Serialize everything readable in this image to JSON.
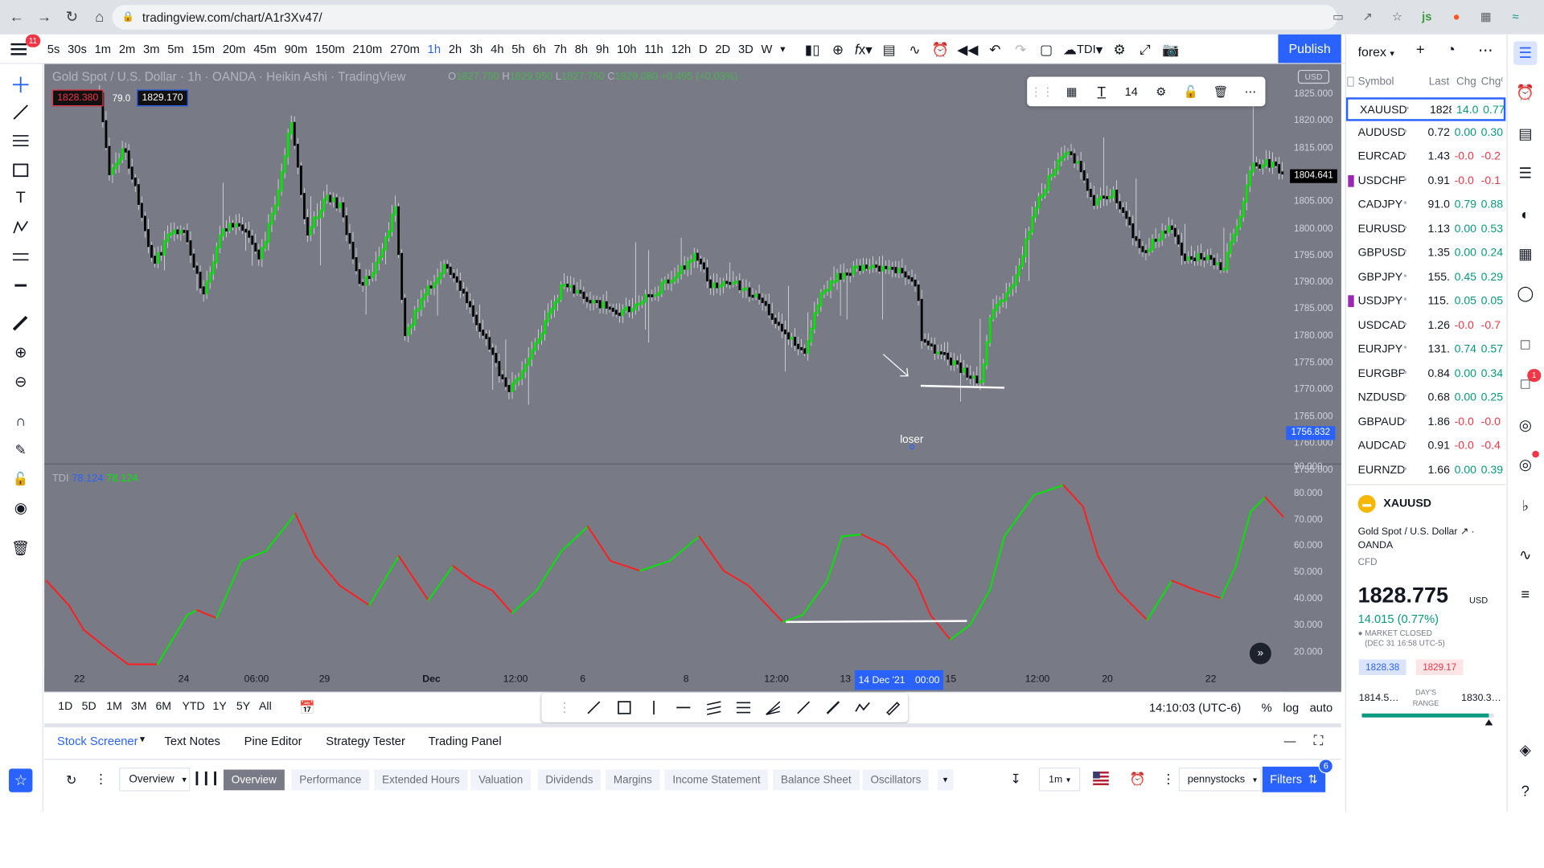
{
  "browser": {
    "url": "tradingview.com/chart/A1r3Xv47/"
  },
  "header": {
    "menu_badge": "11",
    "intervals": [
      "5s",
      "30s",
      "1m",
      "2m",
      "3m",
      "5m",
      "15m",
      "20m",
      "45m",
      "90m",
      "150m",
      "210m",
      "270m",
      "1h",
      "2h",
      "3h",
      "4h",
      "5h",
      "6h",
      "7h",
      "8h",
      "9h",
      "10h",
      "11h",
      "12h",
      "D",
      "2D",
      "3D",
      "W"
    ],
    "active_interval": "1h",
    "indicator_name": "TDI",
    "publish": "Publish"
  },
  "chart": {
    "symbol_title": "Gold Spot / U.S. Dollar · 1h · OANDA · Heikin Ashi · TradingView",
    "ohlc": {
      "o": "1827.750",
      "h": "1829.950",
      "l": "1827.750",
      "c": "1829.080",
      "chg": "+0.495 (+0.03%)"
    },
    "sell": "1828.380",
    "spread": "79.0",
    "buy": "1829.170",
    "currency": "USD",
    "price_ticks": [
      "1825.000",
      "1820.000",
      "1815.000",
      "1810.000",
      "1805.000",
      "1800.000",
      "1795.000",
      "1790.000",
      "1785.000",
      "1780.000",
      "1775.000",
      "1770.000",
      "1765.000",
      "1760.000",
      "1755.000"
    ],
    "last_price_label": "1804.641",
    "crosshair_price": "1756.832",
    "float_toolbar_size": "14",
    "annotation": "loser",
    "tdi_label": "TDI",
    "tdi_v1": "78.124",
    "tdi_v2": "78.124",
    "tdi_ticks": [
      "90.000",
      "80.000",
      "70.000",
      "60.000",
      "50.000",
      "40.000",
      "30.000",
      "20.000"
    ],
    "time_ticks": [
      "22",
      "24",
      "06:00",
      "29",
      "Dec",
      "12:00",
      "6",
      "8",
      "12:00",
      "13",
      "15",
      "12:00",
      "20",
      "22"
    ],
    "crosshair_date": "14 Dec '21",
    "crosshair_time": "00:00",
    "colors": {
      "bg": "#787b86",
      "up": "#00e600",
      "down": "#000000",
      "tdi_up": "#00e600",
      "tdi_down": "#ff1e1e"
    }
  },
  "bottom_bar": {
    "ranges": [
      "1D",
      "5D",
      "1M",
      "3M",
      "6M",
      "YTD",
      "1Y",
      "5Y",
      "All"
    ],
    "clock": "14:10:03 (UTC-6)",
    "pct": "%",
    "log": "log",
    "auto": "auto"
  },
  "panels": {
    "tabs": [
      "Stock Screener",
      "Text Notes",
      "Pine Editor",
      "Strategy Tester",
      "Trading Panel"
    ],
    "screener_view": "Overview",
    "chips": [
      "Overview",
      "Performance",
      "Extended Hours",
      "Valuation",
      "Dividends",
      "Margins",
      "Income Statement",
      "Balance Sheet",
      "Oscillators"
    ],
    "interval": "1m",
    "watch": "pennystocks",
    "filters": "Filters",
    "filters_badge": "6"
  },
  "watchlist": {
    "name": "forex",
    "headers": [
      "Symbol",
      "Last",
      "Chg",
      "Chg%"
    ],
    "rows": [
      {
        "s": "XAUUSD",
        "l": "1828",
        "c": "14.0",
        "p": "0.77",
        "t": "pos"
      },
      {
        "s": "AUDUSD",
        "l": "0.72",
        "c": "0.00",
        "p": "0.30",
        "t": "pos"
      },
      {
        "s": "EURCAD",
        "l": "1.43",
        "c": "-0.0",
        "p": "-0.2",
        "t": "neg"
      },
      {
        "s": "USDCHF",
        "l": "0.91",
        "c": "-0.0",
        "p": "-0.1",
        "t": "neg",
        "flag": true
      },
      {
        "s": "CADJPY",
        "l": "91.0",
        "c": "0.79",
        "p": "0.88",
        "t": "pos"
      },
      {
        "s": "EURUSD",
        "l": "1.13",
        "c": "0.00",
        "p": "0.53",
        "t": "pos"
      },
      {
        "s": "GBPUSD",
        "l": "1.35",
        "c": "0.00",
        "p": "0.24",
        "t": "pos"
      },
      {
        "s": "GBPJPY",
        "l": "155.",
        "c": "0.45",
        "p": "0.29",
        "t": "pos"
      },
      {
        "s": "USDJPY",
        "l": "115.",
        "c": "0.05",
        "p": "0.05",
        "t": "pos",
        "flag": true
      },
      {
        "s": "USDCAD",
        "l": "1.26",
        "c": "-0.0",
        "p": "-0.7",
        "t": "neg"
      },
      {
        "s": "EURJPY",
        "l": "131.",
        "c": "0.74",
        "p": "0.57",
        "t": "pos"
      },
      {
        "s": "EURGBP",
        "l": "0.84",
        "c": "0.00",
        "p": "0.34",
        "t": "pos"
      },
      {
        "s": "NZDUSD",
        "l": "0.68",
        "c": "0.00",
        "p": "0.25",
        "t": "pos"
      },
      {
        "s": "GBPAUD",
        "l": "1.86",
        "c": "-0.0",
        "p": "-0.0",
        "t": "neg"
      },
      {
        "s": "AUDCAD",
        "l": "0.91",
        "c": "-0.0",
        "p": "-0.4",
        "t": "neg"
      },
      {
        "s": "EURNZD",
        "l": "1.66",
        "c": "0.00",
        "p": "0.39",
        "t": "pos"
      }
    ]
  },
  "detail": {
    "symbol": "XAUUSD",
    "name": "Gold Spot / U.S. Dollar",
    "exchange": "OANDA",
    "type": "CFD",
    "price": "1828.775",
    "currency": "USD",
    "change": "14.015 (0.77%)",
    "status": "MARKET CLOSED",
    "status_time": "(DEC 31 16:58 UTC-5)",
    "bid": "1828.38",
    "ask": "1829.17",
    "low": "1814.5…",
    "high": "1830.3…",
    "range_label": "DAY'S RANGE",
    "range_fill": 0.96
  },
  "right_bar": {
    "alert_badge": "1"
  }
}
